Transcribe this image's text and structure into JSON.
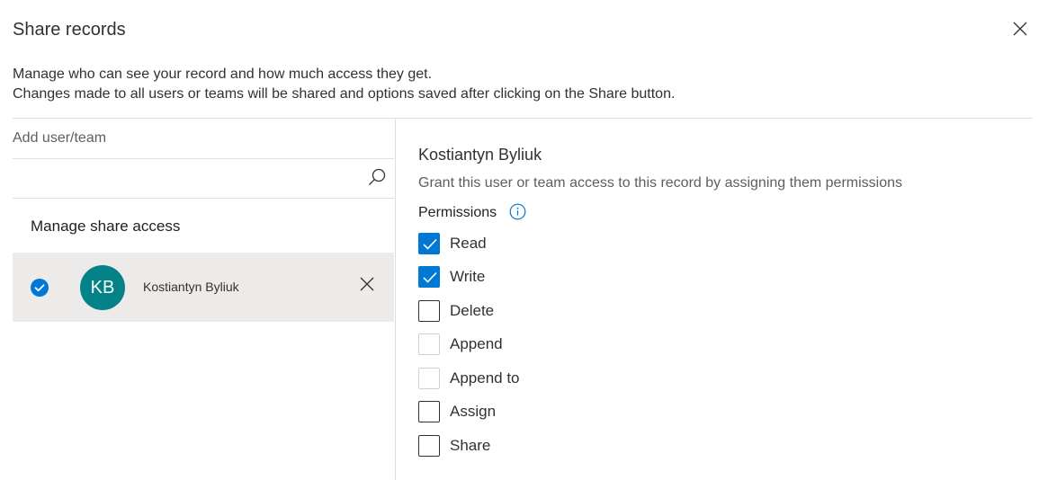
{
  "dialog": {
    "title": "Share records",
    "description_line1": "Manage who can see your record and how much access they get.",
    "description_line2": "Changes made to all users or teams will be shared and options saved after clicking on the Share button."
  },
  "left_panel": {
    "add_label": "Add user/team",
    "search_value": "",
    "manage_heading": "Manage share access",
    "users": [
      {
        "initials": "KB",
        "name": "Kostiantyn Byliuk",
        "selected": true,
        "avatar_color": "#038387"
      }
    ]
  },
  "right_panel": {
    "user_name": "Kostiantyn Byliuk",
    "grant_text": "Grant this user or team access to this record by assigning them permissions",
    "permissions_label": "Permissions",
    "permissions": [
      {
        "label": "Read",
        "checked": true,
        "disabled": false
      },
      {
        "label": "Write",
        "checked": true,
        "disabled": false
      },
      {
        "label": "Delete",
        "checked": false,
        "disabled": false
      },
      {
        "label": "Append",
        "checked": false,
        "disabled": true
      },
      {
        "label": "Append to",
        "checked": false,
        "disabled": true
      },
      {
        "label": "Assign",
        "checked": false,
        "disabled": false
      },
      {
        "label": "Share",
        "checked": false,
        "disabled": false
      }
    ]
  },
  "colors": {
    "accent": "#0078d4",
    "avatar": "#038387",
    "selected_row": "#edebe9"
  },
  "icons": {
    "close": "close-icon",
    "search": "search-icon",
    "info": "info-icon",
    "check": "check-icon",
    "remove": "remove-user-icon"
  }
}
